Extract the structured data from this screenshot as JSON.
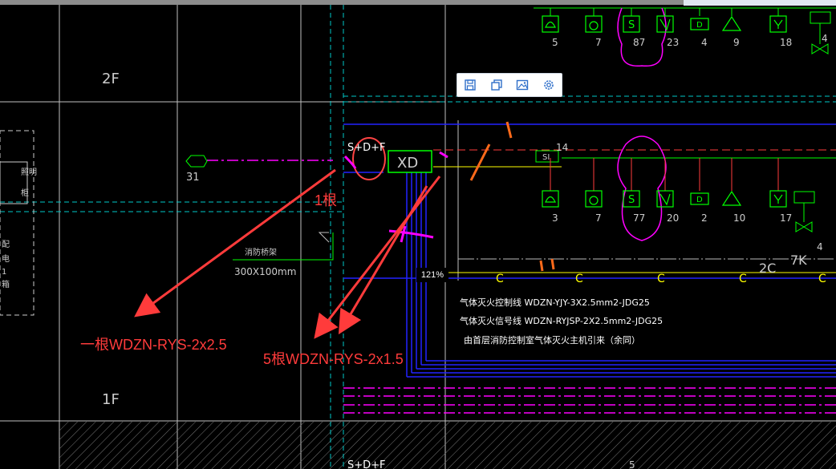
{
  "floors": {
    "upper": "2F",
    "lower": "1F"
  },
  "left_block_text": [
    "照明",
    "柜",
    "配",
    "电",
    "1",
    "箱"
  ],
  "devices_top": [
    {
      "label": "5",
      "icon": "phone-icon"
    },
    {
      "label": "7",
      "icon": "smoke-icon"
    },
    {
      "label": "87",
      "icon": "s-icon"
    },
    {
      "label": "23",
      "icon": "alarm-icon"
    },
    {
      "label": "4",
      "icon": "d-icon"
    },
    {
      "label": "9",
      "icon": "bell-icon"
    },
    {
      "label": "18",
      "icon": "y-icon"
    }
  ],
  "devices_mid": [
    {
      "label": "3",
      "icon": "phone-icon"
    },
    {
      "label": "7",
      "icon": "smoke-icon"
    },
    {
      "label": "77",
      "icon": "s-icon"
    },
    {
      "label": "20",
      "icon": "alarm-icon"
    },
    {
      "label": "2",
      "icon": "d-icon"
    },
    {
      "label": "10",
      "icon": "bell-icon"
    },
    {
      "label": "17",
      "icon": "y-icon"
    }
  ],
  "labels": {
    "device_31": "31",
    "sd_plus": "S+D+F",
    "sd_plus_bottom": "S+D+F",
    "xd": "XD",
    "si": "SI",
    "si_count": "14",
    "duct": "消防桥架",
    "duct_size": "300X100mm",
    "gas_c": "C",
    "zone_2c": "2C",
    "zone_7k": "7K",
    "valve_4": "4",
    "valve_4b": "4",
    "bottom_5": "5",
    "legend1": "气体灭火控制线 WDZN-YJY-3X2.5mm2-JDG25",
    "legend2": "气体灭火信号线 WDZN-RYJSP-2X2.5mm2-JDG25",
    "legend3": "由首层消防控制室气体灭火主机引来（余同）"
  },
  "annotations": {
    "one_root": "1根",
    "cable_one": "一根WDZN-RYS-2x2.5",
    "cable_five": "5根WDZN-RYS-2x1.5"
  },
  "toolbar": {
    "items": [
      {
        "name": "save-icon"
      },
      {
        "name": "copy-icon"
      },
      {
        "name": "image-icon"
      },
      {
        "name": "settings-icon"
      }
    ]
  },
  "zoom": "121%",
  "colors": {
    "device": "#00ff00",
    "magenta": "#ff00ff",
    "blue": "#2222ff",
    "red": "#ff3b3b",
    "cyan": "#00c8c8",
    "yellow": "#ffff00",
    "white": "#ffffff",
    "gray": "#9a9a9a"
  }
}
